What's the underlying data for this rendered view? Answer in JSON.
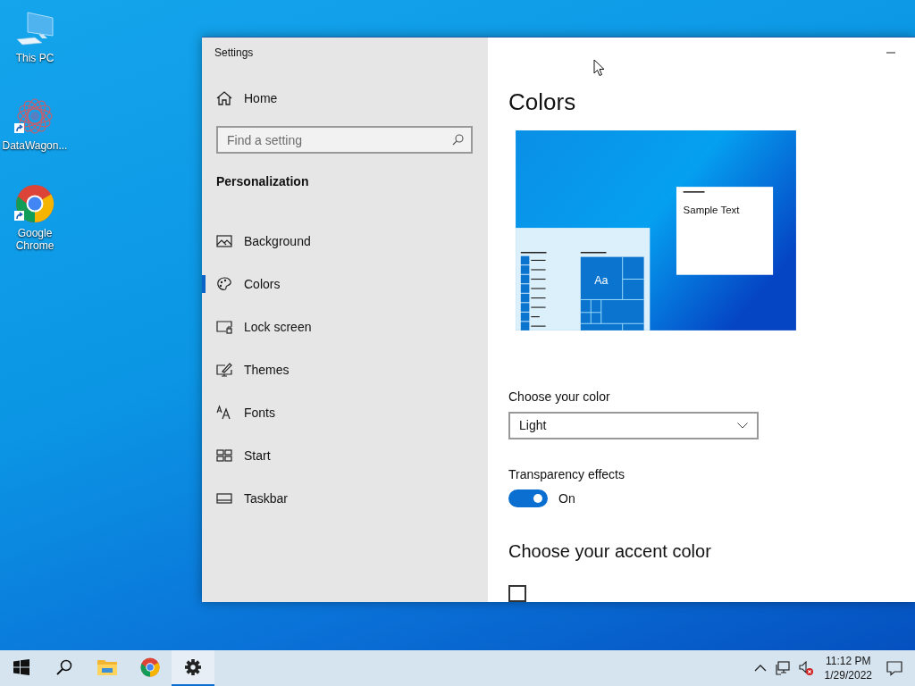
{
  "desktop": {
    "icons": [
      {
        "kind": "computer",
        "label": "This PC",
        "shortcut": false
      },
      {
        "kind": "app",
        "label": "DataWagon...",
        "shortcut": true
      },
      {
        "kind": "chrome",
        "label": "Google Chrome",
        "shortcut": true
      }
    ]
  },
  "window": {
    "title": "Settings",
    "home": "Home",
    "search": {
      "placeholder": "Find a setting"
    },
    "section": "Personalization",
    "nav": [
      {
        "kind": "background",
        "label": "Background",
        "selected": false
      },
      {
        "kind": "colors",
        "label": "Colors",
        "selected": true
      },
      {
        "kind": "lock",
        "label": "Lock screen",
        "selected": false
      },
      {
        "kind": "themes",
        "label": "Themes",
        "selected": false
      },
      {
        "kind": "fonts",
        "label": "Fonts",
        "selected": false
      },
      {
        "kind": "start",
        "label": "Start",
        "selected": false
      },
      {
        "kind": "taskbar",
        "label": "Taskbar",
        "selected": false
      }
    ],
    "content": {
      "heading": "Colors",
      "preview": {
        "tile_text": "Aa",
        "sample_text": "Sample Text"
      },
      "color_label": "Choose your color",
      "color_dropdown": {
        "value": "Light"
      },
      "transparency": {
        "label": "Transparency effects",
        "on": true,
        "state_text": "On"
      },
      "accent_heading": "Choose your accent color",
      "auto_accent": {
        "checked": false
      }
    }
  },
  "taskbar": {
    "items": [
      {
        "kind": "start",
        "selected": false
      },
      {
        "kind": "search",
        "selected": false
      },
      {
        "kind": "explorer",
        "selected": false
      },
      {
        "kind": "chrome",
        "selected": false
      },
      {
        "kind": "settings",
        "selected": true
      }
    ],
    "time": "11:12 PM",
    "date": "1/29/2022"
  }
}
